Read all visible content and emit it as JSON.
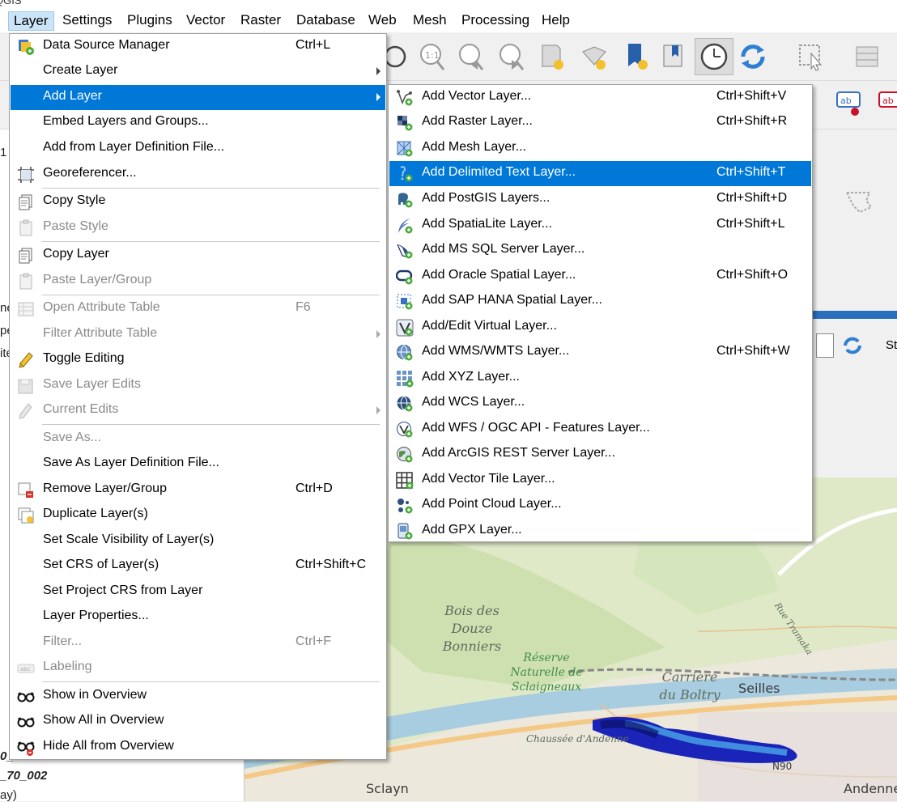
{
  "window": {
    "title_fragment": "QGIS"
  },
  "menubar": {
    "items": [
      "Layer",
      "Settings",
      "Plugins",
      "Vector",
      "Raster",
      "Database",
      "Web",
      "Mesh",
      "Processing",
      "Help"
    ]
  },
  "layer_menu": {
    "items": [
      {
        "label": "Data Source Manager",
        "shortcut": "Ctrl+L",
        "icon": "data-source-manager-icon",
        "enabled": true
      },
      {
        "label": "Create Layer",
        "shortcut": "",
        "icon": "",
        "enabled": true,
        "submenu": true
      },
      {
        "label": "Add Layer",
        "shortcut": "",
        "icon": "",
        "enabled": true,
        "submenu": true,
        "highlighted": true
      },
      {
        "label": "Embed Layers and Groups...",
        "shortcut": "",
        "icon": "",
        "enabled": true
      },
      {
        "label": "Add from Layer Definition File...",
        "shortcut": "",
        "icon": "",
        "enabled": true
      },
      {
        "label": "Georeferencer...",
        "shortcut": "",
        "icon": "georeferencer-icon",
        "enabled": true
      },
      {
        "label": "Copy Style",
        "shortcut": "",
        "icon": "copy-style-icon",
        "enabled": true
      },
      {
        "label": "Paste Style",
        "shortcut": "",
        "icon": "paste-style-icon",
        "enabled": false
      },
      {
        "label": "Copy Layer",
        "shortcut": "",
        "icon": "copy-layer-icon",
        "enabled": true
      },
      {
        "label": "Paste Layer/Group",
        "shortcut": "",
        "icon": "paste-layer-icon",
        "enabled": false
      },
      {
        "label": "Open Attribute Table",
        "shortcut": "F6",
        "icon": "attribute-table-icon",
        "enabled": false
      },
      {
        "label": "Filter Attribute Table",
        "shortcut": "",
        "icon": "",
        "enabled": false,
        "submenu": true
      },
      {
        "label": "Toggle Editing",
        "shortcut": "",
        "icon": "pencil-icon",
        "enabled": true
      },
      {
        "label": "Save Layer Edits",
        "shortcut": "",
        "icon": "save-edits-icon",
        "enabled": false
      },
      {
        "label": "Current Edits",
        "shortcut": "",
        "icon": "current-edits-icon",
        "enabled": false,
        "submenu": true
      },
      {
        "label": "Save As...",
        "shortcut": "",
        "icon": "",
        "enabled": false
      },
      {
        "label": "Save As Layer Definition File...",
        "shortcut": "",
        "icon": "",
        "enabled": true
      },
      {
        "label": "Remove Layer/Group",
        "shortcut": "Ctrl+D",
        "icon": "remove-layer-icon",
        "enabled": true
      },
      {
        "label": "Duplicate Layer(s)",
        "shortcut": "",
        "icon": "duplicate-layer-icon",
        "enabled": true
      },
      {
        "label": "Set Scale Visibility of Layer(s)",
        "shortcut": "",
        "icon": "",
        "enabled": true
      },
      {
        "label": "Set CRS of Layer(s)",
        "shortcut": "Ctrl+Shift+C",
        "icon": "",
        "enabled": true
      },
      {
        "label": "Set Project CRS from Layer",
        "shortcut": "",
        "icon": "",
        "enabled": true
      },
      {
        "label": "Layer Properties...",
        "shortcut": "",
        "icon": "",
        "enabled": true
      },
      {
        "label": "Filter...",
        "shortcut": "Ctrl+F",
        "icon": "",
        "enabled": false
      },
      {
        "label": "Labeling",
        "shortcut": "",
        "icon": "labeling-icon",
        "enabled": false
      },
      {
        "label": "Show in Overview",
        "shortcut": "",
        "icon": "overview-glasses-icon",
        "enabled": true
      },
      {
        "label": "Show All in Overview",
        "shortcut": "",
        "icon": "overview-glasses-icon",
        "enabled": true
      },
      {
        "label": "Hide All from Overview",
        "shortcut": "",
        "icon": "hide-overview-icon",
        "enabled": true
      }
    ]
  },
  "add_layer_menu": {
    "items": [
      {
        "label": "Add Vector Layer...",
        "shortcut": "Ctrl+Shift+V",
        "icon": "vector-layer-icon"
      },
      {
        "label": "Add Raster Layer...",
        "shortcut": "Ctrl+Shift+R",
        "icon": "raster-layer-icon"
      },
      {
        "label": "Add Mesh Layer...",
        "shortcut": "",
        "icon": "mesh-layer-icon"
      },
      {
        "label": "Add Delimited Text Layer...",
        "shortcut": "Ctrl+Shift+T",
        "icon": "delimited-text-icon",
        "highlighted": true
      },
      {
        "label": "Add PostGIS Layers...",
        "shortcut": "Ctrl+Shift+D",
        "icon": "postgis-elephant-icon"
      },
      {
        "label": "Add SpatiaLite Layer...",
        "shortcut": "Ctrl+Shift+L",
        "icon": "spatialite-feather-icon"
      },
      {
        "label": "Add MS SQL Server Layer...",
        "shortcut": "",
        "icon": "mssql-icon"
      },
      {
        "label": "Add Oracle Spatial Layer...",
        "shortcut": "Ctrl+Shift+O",
        "icon": "oracle-icon"
      },
      {
        "label": "Add SAP HANA Spatial Layer...",
        "shortcut": "",
        "icon": "sap-hana-icon"
      },
      {
        "label": "Add/Edit Virtual Layer...",
        "shortcut": "",
        "icon": "virtual-layer-icon"
      },
      {
        "label": "Add WMS/WMTS Layer...",
        "shortcut": "Ctrl+Shift+W",
        "icon": "wms-globe-icon"
      },
      {
        "label": "Add XYZ Layer...",
        "shortcut": "",
        "icon": "xyz-grid-icon"
      },
      {
        "label": "Add WCS Layer...",
        "shortcut": "",
        "icon": "wcs-globe-icon"
      },
      {
        "label": "Add WFS / OGC API - Features Layer...",
        "shortcut": "",
        "icon": "wfs-icon"
      },
      {
        "label": "Add ArcGIS REST Server Layer...",
        "shortcut": "",
        "icon": "arcgis-globe-icon"
      },
      {
        "label": "Add Vector Tile Layer...",
        "shortcut": "",
        "icon": "vector-tile-icon"
      },
      {
        "label": "Add Point Cloud Layer...",
        "shortcut": "",
        "icon": "point-cloud-icon"
      },
      {
        "label": "Add GPX Layer...",
        "shortcut": "",
        "icon": "gpx-icon"
      }
    ]
  },
  "map": {
    "labels": [
      "Bois des Douze Bonniers",
      "Réserve Naturelle de Sclaigneaux",
      "Carrière du Boltry",
      "Seilles",
      "Chaussée d'Andenne",
      "Sclayn",
      "Andenne",
      "Rue Tramaka",
      "N90"
    ]
  },
  "left_panel": {
    "fragments": [
      "1",
      "ne",
      "pe",
      "ite",
      "_70_002",
      "ay)",
      "0_"
    ]
  },
  "right_panel": {
    "fragment": "Ste"
  },
  "colors": {
    "highlight": "#0078d7",
    "menu_active": "#cce4f7",
    "heatmap": "#2a3bd6"
  }
}
